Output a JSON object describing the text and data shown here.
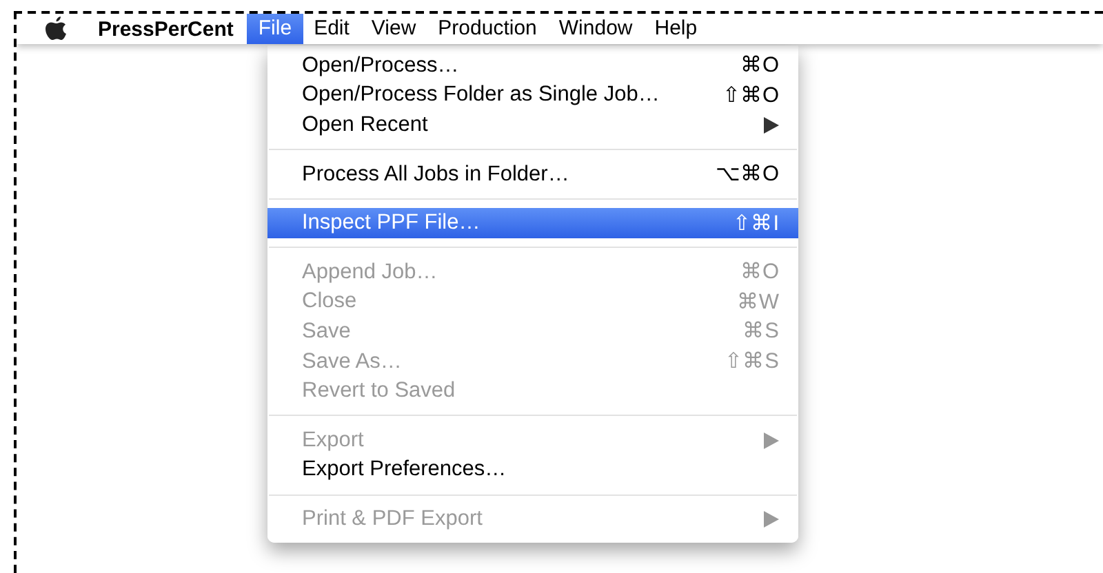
{
  "menu_bar": {
    "app_name": "PressPerCent",
    "menus": [
      {
        "label": "File",
        "selected": true
      },
      {
        "label": "Edit",
        "selected": false
      },
      {
        "label": "View",
        "selected": false
      },
      {
        "label": "Production",
        "selected": false
      },
      {
        "label": "Window",
        "selected": false
      },
      {
        "label": "Help",
        "selected": false
      }
    ]
  },
  "file_menu": {
    "items": [
      {
        "kind": "item",
        "label": "Open/Process…",
        "shortcut": "⌘O",
        "disabled": false,
        "selected": false,
        "submenu": false
      },
      {
        "kind": "item",
        "label": "Open/Process Folder as Single Job…",
        "shortcut": "⇧⌘O",
        "disabled": false,
        "selected": false,
        "submenu": false
      },
      {
        "kind": "item",
        "label": "Open Recent",
        "disabled": false,
        "selected": false,
        "submenu": true
      },
      {
        "kind": "separator"
      },
      {
        "kind": "item",
        "label": "Process All Jobs in Folder…",
        "shortcut": "⌥⌘O",
        "disabled": false,
        "selected": false,
        "submenu": false
      },
      {
        "kind": "separator"
      },
      {
        "kind": "item",
        "label": "Inspect PPF File…",
        "shortcut": "⇧⌘I",
        "disabled": false,
        "selected": true,
        "submenu": false
      },
      {
        "kind": "separator"
      },
      {
        "kind": "item",
        "label": "Append Job…",
        "shortcut": "⌘O",
        "disabled": true,
        "selected": false,
        "submenu": false
      },
      {
        "kind": "item",
        "label": "Close",
        "shortcut": "⌘W",
        "disabled": true,
        "selected": false,
        "submenu": false
      },
      {
        "kind": "item",
        "label": "Save",
        "shortcut": "⌘S",
        "disabled": true,
        "selected": false,
        "submenu": false
      },
      {
        "kind": "item",
        "label": "Save As…",
        "shortcut": "⇧⌘S",
        "disabled": true,
        "selected": false,
        "submenu": false
      },
      {
        "kind": "item",
        "label": "Revert to Saved",
        "disabled": true,
        "selected": false,
        "submenu": false
      },
      {
        "kind": "separator"
      },
      {
        "kind": "item",
        "label": "Export",
        "disabled": true,
        "selected": false,
        "submenu": true
      },
      {
        "kind": "item",
        "label": "Export Preferences…",
        "disabled": false,
        "selected": false,
        "submenu": false
      },
      {
        "kind": "separator"
      },
      {
        "kind": "item",
        "label": "Print & PDF Export",
        "disabled": true,
        "selected": false,
        "submenu": true
      }
    ]
  }
}
